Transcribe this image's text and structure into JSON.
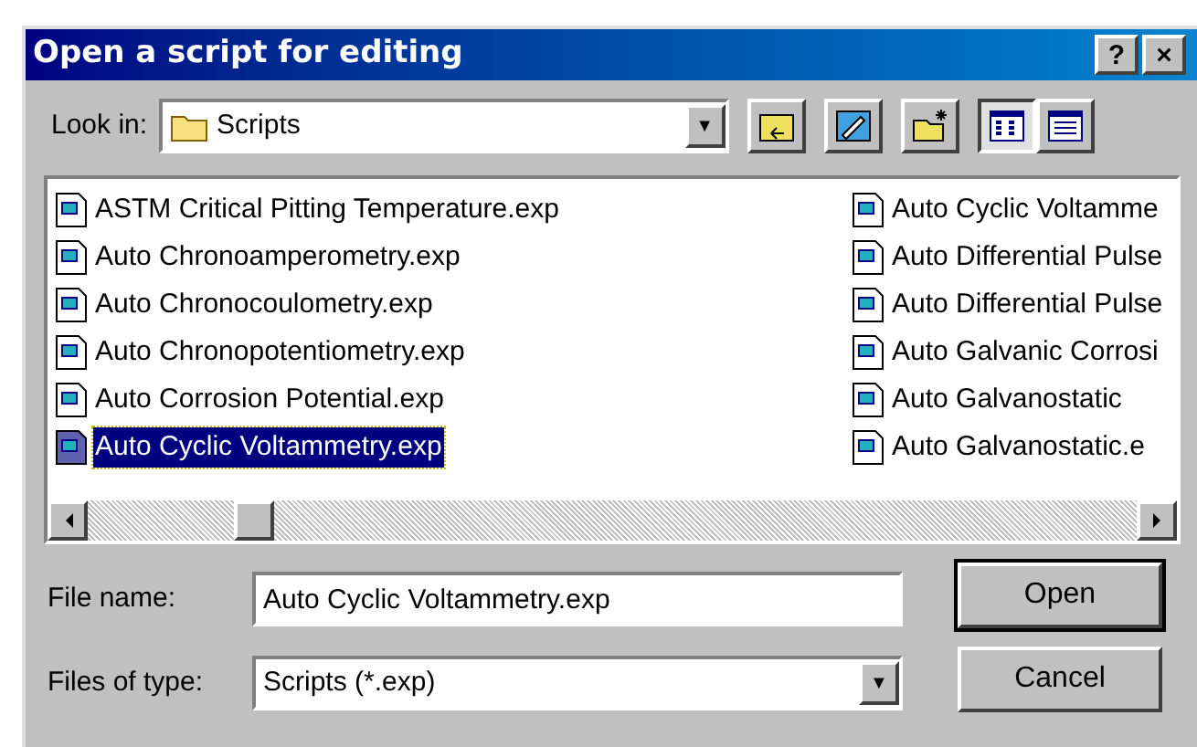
{
  "window": {
    "title": "Open a script for editing",
    "title_buttons": [
      "?",
      "×"
    ]
  },
  "look_in": {
    "label": "Look in:",
    "value": "Scripts",
    "arrow": "▼"
  },
  "toolbar": [
    {
      "kind": "up",
      "selected": false
    },
    {
      "kind": "desktop",
      "selected": false
    },
    {
      "kind": "new_folder",
      "selected": false
    },
    {
      "kind": "list",
      "selected": true
    },
    {
      "kind": "details",
      "selected": false
    }
  ],
  "file_list": {
    "columns": [
      [
        {
          "name": "ASTM Critical Pitting Temperature.exp",
          "selected": false
        },
        {
          "name": "Auto Chronoamperometry.exp",
          "selected": false
        },
        {
          "name": "Auto Chronocoulometry.exp",
          "selected": false
        },
        {
          "name": "Auto Chronopotentiometry.exp",
          "selected": false
        },
        {
          "name": "Auto Corrosion Potential.exp",
          "selected": false
        },
        {
          "name": "Auto Cyclic Voltammetry.exp",
          "selected": true
        }
      ],
      [
        {
          "name": "Auto Cyclic Voltamme",
          "selected": false
        },
        {
          "name": "Auto Differential Pulse",
          "selected": false
        },
        {
          "name": "Auto Differential Pulse",
          "selected": false
        },
        {
          "name": "Auto Galvanic Corrosi",
          "selected": false
        },
        {
          "name": "Auto Galvanostatic",
          "selected": false
        },
        {
          "name": "Auto Galvanostatic.e",
          "selected": false
        }
      ]
    ]
  },
  "file_name": {
    "label": "File name:",
    "value": "Auto Cyclic Voltammetry.exp"
  },
  "file_type": {
    "label": "Files of type:",
    "value": "Scripts (*.exp)",
    "arrow": "▼"
  },
  "buttons": [
    {
      "label": "Open",
      "default": true
    },
    {
      "label": "Cancel",
      "default": false
    }
  ]
}
